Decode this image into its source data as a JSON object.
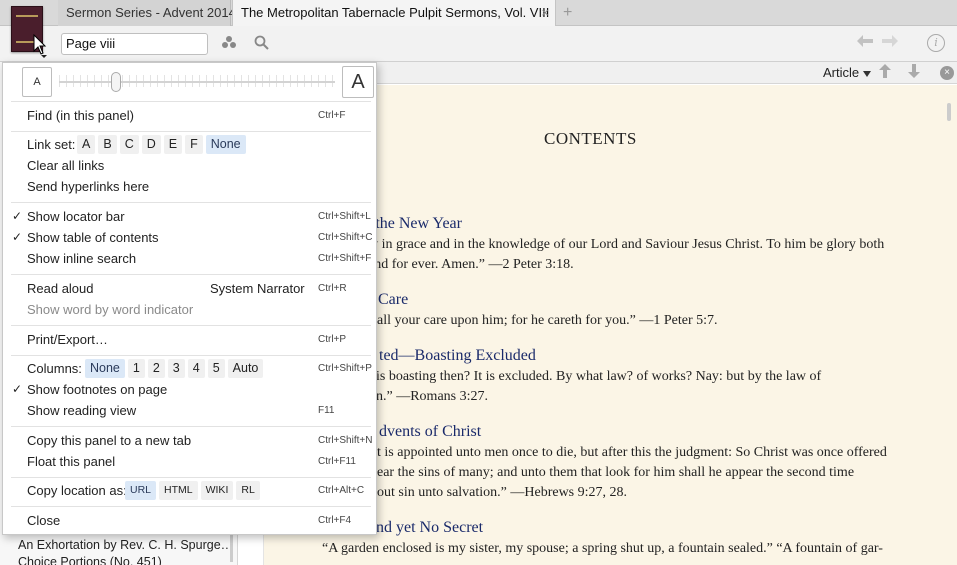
{
  "tabs": {
    "inactive_label": "Sermon Series - Advent 2014",
    "active_label": "The Metropolitan Tabernacle Pulpit Sermons, Vol. VIII",
    "close_glyph": "×",
    "new_tab_glyph": "+"
  },
  "toolbar": {
    "reference_value": "Page viii"
  },
  "content_header": {
    "article_label": "Article"
  },
  "content": {
    "title": "CONTENTS",
    "sermons": [
      {
        "title": "r the New Year",
        "lines": [
          "w in grace and in the knowledge of our Lord and Saviour Jesus Christ. To him be glory both",
          " and for ever. Amen.” —2 Peter 3:18."
        ]
      },
      {
        "title": "Care",
        "lines": [
          "all your care upon him; for he careth for you.” —1 Peter 5:7."
        ]
      },
      {
        "title": "ted—Boasting Excluded",
        "lines": [
          "is boasting then? It is excluded. By what law? of works? Nay: but by the law of",
          "n.” —Romans 3:27."
        ]
      },
      {
        "title": "dvents of Christ",
        "lines": [
          "t is appointed unto men once to die, but after this the judgment: So Christ was once offered",
          "ear the sins of many; and unto them that look for him shall he appear the second time",
          "out sin unto salvation.” —Hebrews 9:27, 28."
        ]
      },
      {
        "title": "nd yet No Secret",
        "lines": [
          "“A garden enclosed is my sister, my spouse; a spring shut up, a fountain sealed.” “A fountain of gar-"
        ]
      }
    ]
  },
  "left_panel": {
    "entries": [
      "An Exhortation by Rev. C. H. Spurge…",
      "Choice Portions (No. 451)"
    ]
  },
  "menu": {
    "font_small": "A",
    "font_large": "A",
    "font_level": 0.2,
    "find_label": "Find (in this panel)",
    "find_shortcut": "Ctrl+F",
    "linkset_label": "Link set:",
    "linkset_options": [
      "A",
      "B",
      "C",
      "D",
      "E",
      "F",
      "None"
    ],
    "linkset_selected": "None",
    "clear_links_label": "Clear all links",
    "send_links_label": "Send hyperlinks here",
    "show_locator_label": "Show locator bar",
    "show_locator_shortcut": "Ctrl+Shift+L",
    "show_toc_label": "Show table of contents",
    "show_toc_shortcut": "Ctrl+Shift+C",
    "show_inline_label": "Show inline search",
    "show_inline_shortcut": "Ctrl+Shift+F",
    "read_aloud_label": "Read aloud",
    "read_aloud_voice": "System Narrator",
    "read_aloud_shortcut": "Ctrl+R",
    "word_indicator_label": "Show word by word indicator",
    "print_label": "Print/Export…",
    "print_shortcut": "Ctrl+P",
    "columns_label": "Columns:",
    "columns_options": [
      "None",
      "1",
      "2",
      "3",
      "4",
      "5",
      "Auto"
    ],
    "columns_selected": "None",
    "columns_shortcut": "Ctrl+Shift+P",
    "footnotes_label": "Show footnotes on page",
    "reading_view_label": "Show reading view",
    "reading_view_shortcut": "F11",
    "copy_panel_label": "Copy this panel to a new tab",
    "copy_panel_shortcut": "Ctrl+Shift+N",
    "float_panel_label": "Float this panel",
    "float_panel_shortcut": "Ctrl+F11",
    "copy_location_label": "Copy location as:",
    "copy_location_options": [
      "URL",
      "HTML",
      "WIKI",
      "RL"
    ],
    "copy_location_selected": "URL",
    "copy_location_shortcut": "Ctrl+Alt+C",
    "close_label": "Close",
    "close_shortcut": "Ctrl+F4",
    "check_glyph": "✓"
  }
}
